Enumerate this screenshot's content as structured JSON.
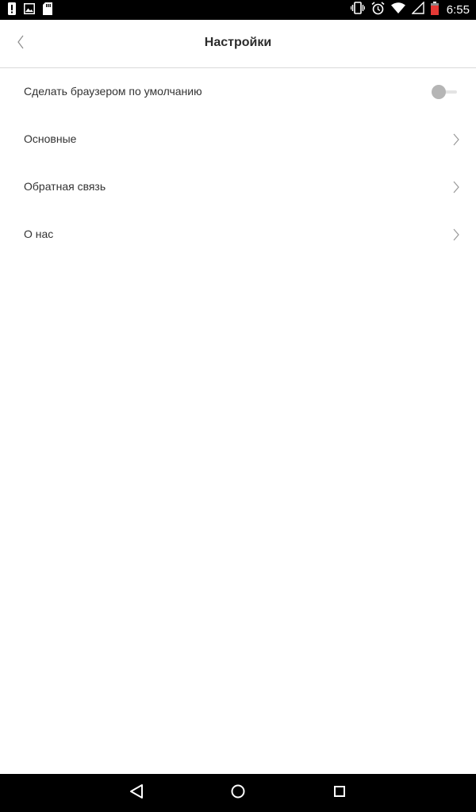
{
  "status_bar": {
    "time": "6:55",
    "left_icons": [
      "alert-icon",
      "image-icon",
      "sd-card-icon"
    ],
    "right_icons": [
      "vibrate-icon",
      "alarm-icon",
      "wifi-icon",
      "signal-icon",
      "battery-icon"
    ]
  },
  "header": {
    "title": "Настройки",
    "back_icon": "chevron-left-icon"
  },
  "settings": {
    "items": [
      {
        "label": "Сделать браузером по умолчанию",
        "control": "toggle",
        "toggle_on": false
      },
      {
        "label": "Основные",
        "control": "chevron"
      },
      {
        "label": "Обратная связь",
        "control": "chevron"
      },
      {
        "label": "О нас",
        "control": "chevron"
      }
    ]
  },
  "nav_bar": {
    "buttons": [
      "back-triangle-icon",
      "home-circle-icon",
      "recents-square-icon"
    ]
  },
  "colors": {
    "status_bar_bg": "#000000",
    "text_primary": "#333333",
    "divider": "#d9d9d9",
    "toggle_knob_off": "#b5b5b5",
    "chevron": "#999999"
  }
}
